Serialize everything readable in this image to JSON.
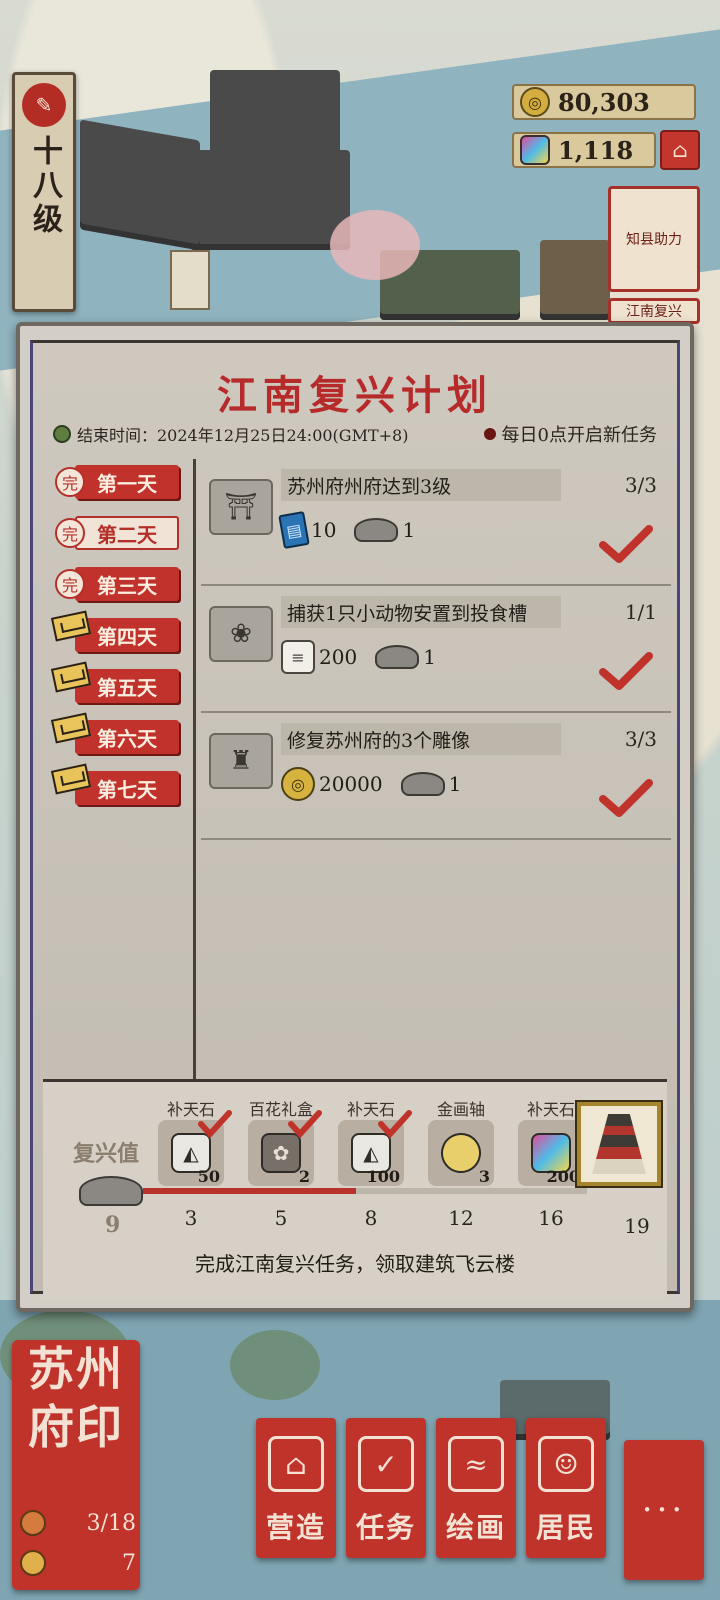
{
  "hud": {
    "level_label": "十八级",
    "coins": "80,303",
    "gems": "1,118",
    "side_card_1": "知县助力",
    "side_card_2": "江南复兴"
  },
  "panel": {
    "title": "江南复兴计划",
    "end_time": "结束时间：2024年12月25日24:00(GMT+8)",
    "daily_note": "每日0点开启新任务",
    "days": [
      {
        "label": "第一天",
        "state": "done",
        "mark": "完"
      },
      {
        "label": "第二天",
        "state": "done-selected",
        "mark": "完"
      },
      {
        "label": "第三天",
        "state": "done",
        "mark": "完"
      },
      {
        "label": "第四天",
        "state": "locked"
      },
      {
        "label": "第五天",
        "state": "locked"
      },
      {
        "label": "第六天",
        "state": "locked"
      },
      {
        "label": "第七天",
        "state": "locked"
      }
    ],
    "tasks": [
      {
        "name": "苏州府州府达到3级",
        "progress": "3/3",
        "reward1_icon": "ticket-icon",
        "reward1": "10",
        "reward2_icon": "hat-icon",
        "reward2": "1"
      },
      {
        "name": "捕获1只小动物安置到投食槽",
        "progress": "1/1",
        "reward1_icon": "scroll-icon",
        "reward1": "200",
        "reward2_icon": "hat-icon",
        "reward2": "1"
      },
      {
        "name": "修复苏州府的3个雕像",
        "progress": "3/3",
        "reward1_icon": "coin-icon",
        "reward1": "20000",
        "reward2_icon": "hat-icon",
        "reward2": "1"
      }
    ],
    "revival": {
      "label": "复兴值",
      "value": "9",
      "progress_fraction": 0.48,
      "nodes": [
        {
          "name": "补天石",
          "count": "50",
          "threshold": "3",
          "claimed": true,
          "icon": "stone-icon"
        },
        {
          "name": "百花礼盒",
          "count": "2",
          "threshold": "5",
          "claimed": true,
          "icon": "gift-box-icon"
        },
        {
          "name": "补天石",
          "count": "100",
          "threshold": "8",
          "claimed": true,
          "icon": "stone-icon"
        },
        {
          "name": "金画轴",
          "count": "3",
          "threshold": "12",
          "claimed": false,
          "icon": "gold-scroll-icon"
        },
        {
          "name": "补天石",
          "count": "200",
          "threshold": "16",
          "claimed": false,
          "icon": "gem-stone-icon"
        }
      ],
      "final_threshold": "19",
      "caption": "完成江南复兴任务，领取建筑飞云楼"
    }
  },
  "bottom": {
    "seal_title_line1": "苏州",
    "seal_title_line2": "府印",
    "stat1": "3/18",
    "stat2": "7",
    "buttons": [
      "营造",
      "任务",
      "绘画",
      "居民"
    ],
    "more": "···"
  },
  "colors": {
    "accent_red": "#c0332b",
    "title_red": "#b72a2a",
    "paper": "#cbc5bb"
  }
}
